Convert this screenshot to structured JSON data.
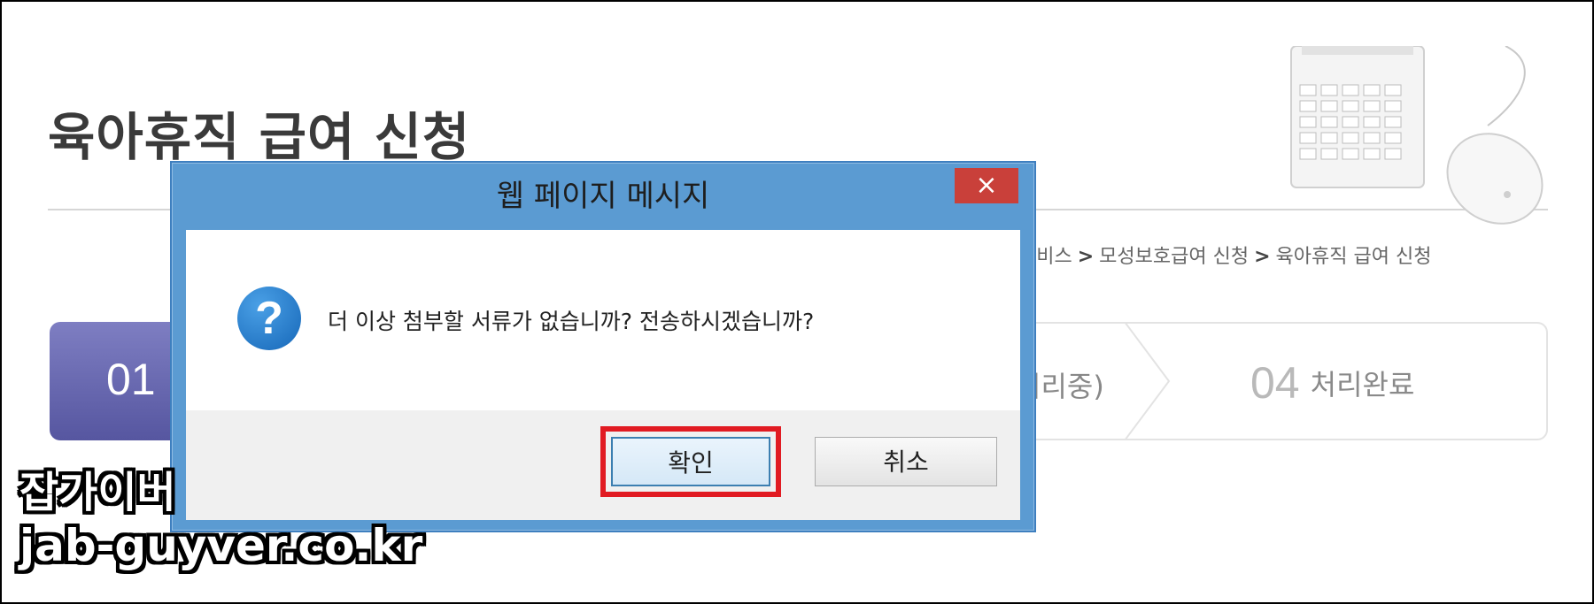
{
  "page": {
    "title": "육아휴직 급여 신청",
    "breadcrumb": [
      "서비스",
      "모성보호급여 신청",
      "육아휴직 급여 신청"
    ],
    "breadcrumb_sep": ">"
  },
  "steps": [
    {
      "number": "01",
      "label": "",
      "active": true
    },
    {
      "number": "",
      "label": "처리중)",
      "active": false
    },
    {
      "number": "04",
      "label": "처리완료",
      "active": false
    }
  ],
  "dialog": {
    "title": "웹 페이지 메시지",
    "close_label": "×",
    "icon": "question-icon",
    "message": "더 이상 첨부할 서류가 없습니까? 전송하시겠습니까?",
    "ok_label": "확인",
    "cancel_label": "취소",
    "highlight_color": "#e11b22"
  },
  "watermark": {
    "line1": "잡가이버",
    "line2": "jab-guyver.co.kr"
  },
  "colors": {
    "dialog_frame": "#5b9bd2",
    "close_button": "#c9403a",
    "step_active": "#6a6ab2",
    "question_icon": "#1f78c8"
  }
}
